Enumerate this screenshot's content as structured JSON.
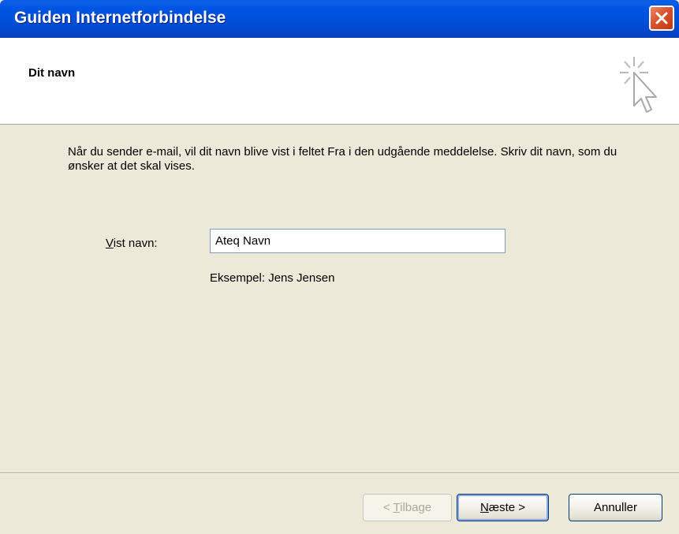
{
  "window": {
    "title": "Guiden Internetforbindelse"
  },
  "header": {
    "heading": "Dit navn",
    "icon": "wizard-cursor-icon"
  },
  "body": {
    "description": "Når du sender e-mail, vil dit navn blive vist i feltet Fra i den udgående meddelelse. Skriv dit navn, som du ønsker at det skal vises.",
    "field_label_accel": "V",
    "field_label_rest": "ist navn:",
    "name_value": "Ateq Navn",
    "example": "Eksempel: Jens Jensen"
  },
  "buttons": {
    "back_prefix": "< ",
    "back_accel": "T",
    "back_rest": "ilbage",
    "next_accel": "N",
    "next_rest": "æste >",
    "cancel": "Annuller"
  },
  "colors": {
    "titlebar": "#0055e5",
    "close": "#d9532e",
    "background": "#ece9d8"
  }
}
